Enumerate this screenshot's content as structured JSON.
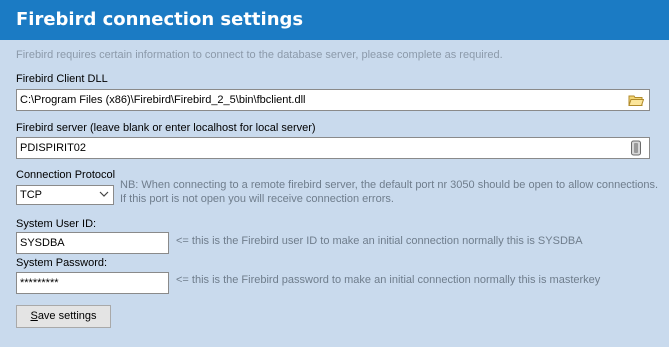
{
  "header": {
    "title": "Firebird connection settings"
  },
  "intro": "Firebird requires certain information to connect to the database server, please complete as required.",
  "client_dll": {
    "label": "Firebird Client DLL",
    "value": "C:\\Program Files (x86)\\Firebird\\Firebird_2_5\\bin\\fbclient.dll",
    "icon": "folder-icon"
  },
  "server": {
    "label": "Firebird server (leave blank or enter localhost for local server)",
    "value": "PDISPIRIT02",
    "icon": "server-icon"
  },
  "protocol": {
    "label": "Connection Protocol",
    "value": "TCP",
    "note_line1": "NB: When connecting to a remote firebird server, the default port nr 3050 should be open to allow connections.",
    "note_line2": "If this port is not open you will receive connection errors."
  },
  "user": {
    "label": "System User ID:",
    "value": "SYSDBA",
    "hint": "<= this is the Firebird user ID to make an initial connection normally this is SYSDBA"
  },
  "password": {
    "label": "System Password:",
    "value": "*********",
    "hint": "<= this is the Firebird password to make an initial connection normally this is masterkey"
  },
  "save_button": {
    "label_first": "S",
    "label_rest": "ave settings"
  },
  "colors": {
    "header": "#1b7bc4",
    "background": "#c9daed"
  }
}
